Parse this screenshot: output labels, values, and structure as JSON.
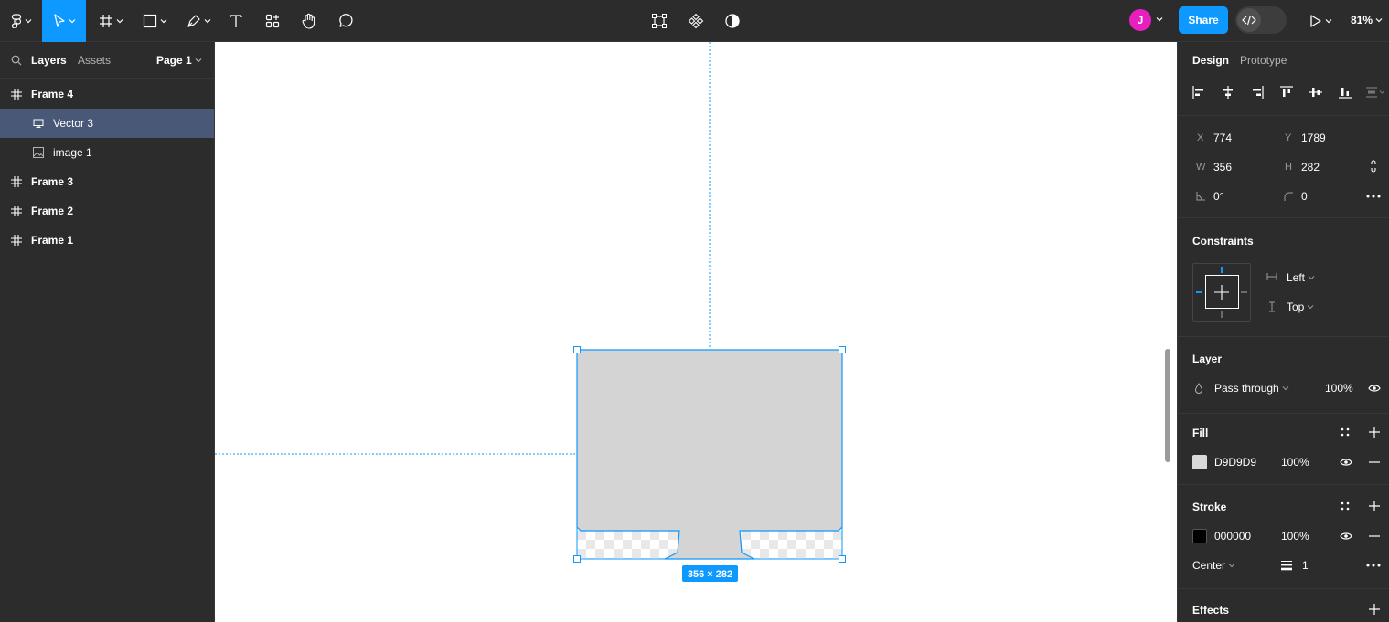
{
  "toolbar": {
    "tools": [
      "figma-menu",
      "move",
      "frame",
      "shape",
      "pen",
      "text",
      "actions",
      "hand",
      "comment"
    ],
    "center_tools": [
      "transform",
      "component",
      "mask-contrast"
    ],
    "avatar_initial": "J",
    "share_label": "Share",
    "zoom_label": "81%"
  },
  "left_panel": {
    "tab_layers": "Layers",
    "tab_assets": "Assets",
    "page_label": "Page 1",
    "layers": [
      {
        "name": "Frame 4",
        "type": "frame"
      },
      {
        "name": "Vector 3",
        "type": "vector",
        "selected": true
      },
      {
        "name": "image 1",
        "type": "image"
      },
      {
        "name": "Frame 3",
        "type": "frame"
      },
      {
        "name": "Frame 2",
        "type": "frame"
      },
      {
        "name": "Frame 1",
        "type": "frame"
      }
    ]
  },
  "canvas": {
    "size_badge": "356 × 282",
    "accent": "#0d99ff",
    "shape_fill": "#d9d9d9"
  },
  "right_panel": {
    "tab_design": "Design",
    "tab_prototype": "Prototype",
    "x_label": "X",
    "x_value": "774",
    "y_label": "Y",
    "y_value": "1789",
    "w_label": "W",
    "w_value": "356",
    "h_label": "H",
    "h_value": "282",
    "rotation_value": "0°",
    "radius_value": "0",
    "constraints_title": "Constraints",
    "constraint_h": "Left",
    "constraint_v": "Top",
    "layer_title": "Layer",
    "blend_mode": "Pass through",
    "layer_opacity": "100%",
    "fill_title": "Fill",
    "fill_hex": "D9D9D9",
    "fill_color": "#d9d9d9",
    "fill_opacity": "100%",
    "stroke_title": "Stroke",
    "stroke_hex": "000000",
    "stroke_color": "#000000",
    "stroke_opacity": "100%",
    "stroke_position": "Center",
    "stroke_weight": "1",
    "effects_title": "Effects"
  }
}
